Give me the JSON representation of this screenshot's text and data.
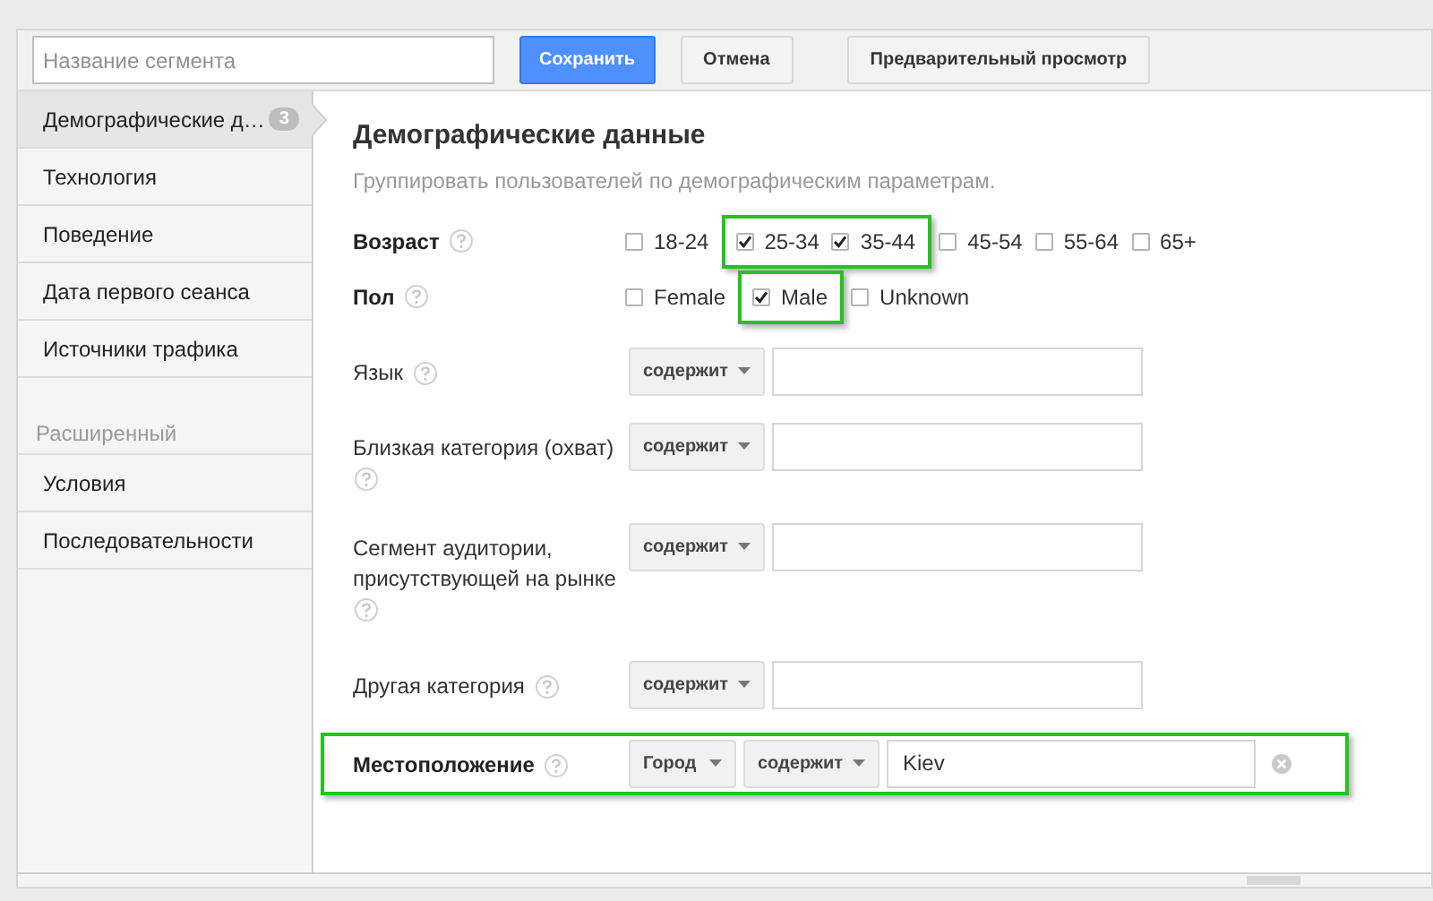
{
  "segment_name": {
    "placeholder": "Название сегмента"
  },
  "buttons": [
    {
      "label": "Сохранить",
      "kind": "primary"
    },
    {
      "label": "Отмена",
      "kind": "default"
    },
    {
      "label": "Предварительный просмотр",
      "kind": "default"
    }
  ],
  "sidebar": {
    "items": [
      {
        "label": "Демографические д…",
        "badge": "3",
        "selected": true
      },
      {
        "label": "Технология",
        "selected": false
      },
      {
        "label": "Поведение",
        "selected": false
      },
      {
        "label": "Дата первого сеанса",
        "selected": false
      },
      {
        "label": "Источники трафика",
        "selected": false
      }
    ],
    "section": "Расширенный",
    "advanced_items": [
      {
        "label": "Условия",
        "selected": false
      },
      {
        "label": "Последовательности",
        "selected": false
      }
    ]
  },
  "content": {
    "title": "Демографические данные",
    "subtitle": "Группировать пользователей по демографическим параметрам.",
    "age": {
      "label": "Возраст",
      "options": [
        {
          "label": "18-24",
          "checked": false,
          "highlighted": false
        },
        {
          "label": "25-34",
          "checked": true,
          "highlighted": true
        },
        {
          "label": "35-44",
          "checked": true,
          "highlighted": true
        },
        {
          "label": "45-54",
          "checked": false,
          "highlighted": false
        },
        {
          "label": "55-64",
          "checked": false,
          "highlighted": false
        },
        {
          "label": "65+",
          "checked": false,
          "highlighted": false
        }
      ]
    },
    "gender": {
      "label": "Пол",
      "options": [
        {
          "label": "Female",
          "checked": false,
          "highlighted": false
        },
        {
          "label": "Male",
          "checked": true,
          "highlighted": true
        },
        {
          "label": "Unknown",
          "checked": false,
          "highlighted": false
        }
      ]
    },
    "conditions": [
      {
        "label": "Язык",
        "operator": "содержит",
        "highlighted": false
      },
      {
        "label": "Близкая категория (охват)",
        "operator": "содержит",
        "highlighted": false
      },
      {
        "label": "Сегмент аудитории, присутствующей на рынке",
        "operator": "содержит",
        "highlighted": false
      },
      {
        "label": "Другая категория",
        "operator": "содержит",
        "highlighted": false
      },
      {
        "label": "Местоположение",
        "scope": "Город",
        "operator": "содержит",
        "value": "Kiev",
        "highlighted": true
      }
    ]
  }
}
